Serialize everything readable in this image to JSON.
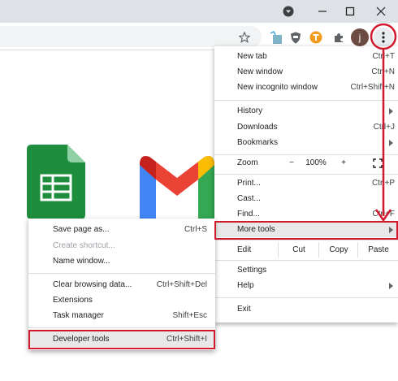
{
  "window": {
    "controls": [
      "minimize",
      "maximize",
      "close"
    ]
  },
  "colors": {
    "highlight": "#d0192d",
    "menu_hover": "#e8e8e8",
    "sheets_green": "#1e8e3e"
  },
  "main_menu": {
    "new_tab": {
      "label": "New tab",
      "shortcut": "Ctrl+T"
    },
    "new_window": {
      "label": "New window",
      "shortcut": "Ctrl+N"
    },
    "new_incognito": {
      "label": "New incognito window",
      "shortcut": "Ctrl+Shift+N"
    },
    "history": {
      "label": "History"
    },
    "downloads": {
      "label": "Downloads",
      "shortcut": "Ctrl+J"
    },
    "bookmarks": {
      "label": "Bookmarks"
    },
    "zoom": {
      "label": "Zoom",
      "minus": "−",
      "value": "100%",
      "plus": "+"
    },
    "print": {
      "label": "Print...",
      "shortcut": "Ctrl+P"
    },
    "cast": {
      "label": "Cast..."
    },
    "find": {
      "label": "Find...",
      "shortcut": "Ctrl+F"
    },
    "more_tools": {
      "label": "More tools"
    },
    "edit": {
      "label": "Edit",
      "cut": "Cut",
      "copy": "Copy",
      "paste": "Paste"
    },
    "settings": {
      "label": "Settings"
    },
    "help": {
      "label": "Help"
    },
    "exit": {
      "label": "Exit"
    }
  },
  "more_tools_menu": {
    "save_page": {
      "label": "Save page as...",
      "shortcut": "Ctrl+S"
    },
    "create_shortcut": {
      "label": "Create shortcut..."
    },
    "name_window": {
      "label": "Name window..."
    },
    "clear_browsing": {
      "label": "Clear browsing data...",
      "shortcut": "Ctrl+Shift+Del"
    },
    "extensions": {
      "label": "Extensions"
    },
    "task_manager": {
      "label": "Task manager",
      "shortcut": "Shift+Esc"
    },
    "developer_tools": {
      "label": "Developer tools",
      "shortcut": "Ctrl+Shift+I"
    }
  },
  "profile": {
    "initial": "j"
  },
  "icons": [
    "profile-dropdown-icon",
    "minimize-icon",
    "maximize-icon",
    "close-icon",
    "bookmark-star-icon",
    "extension-icon",
    "puzzle-icon",
    "kebab-menu-icon",
    "sheets-app-icon",
    "gmail-app-icon",
    "fullscreen-icon",
    "submenu-arrow-icon"
  ]
}
